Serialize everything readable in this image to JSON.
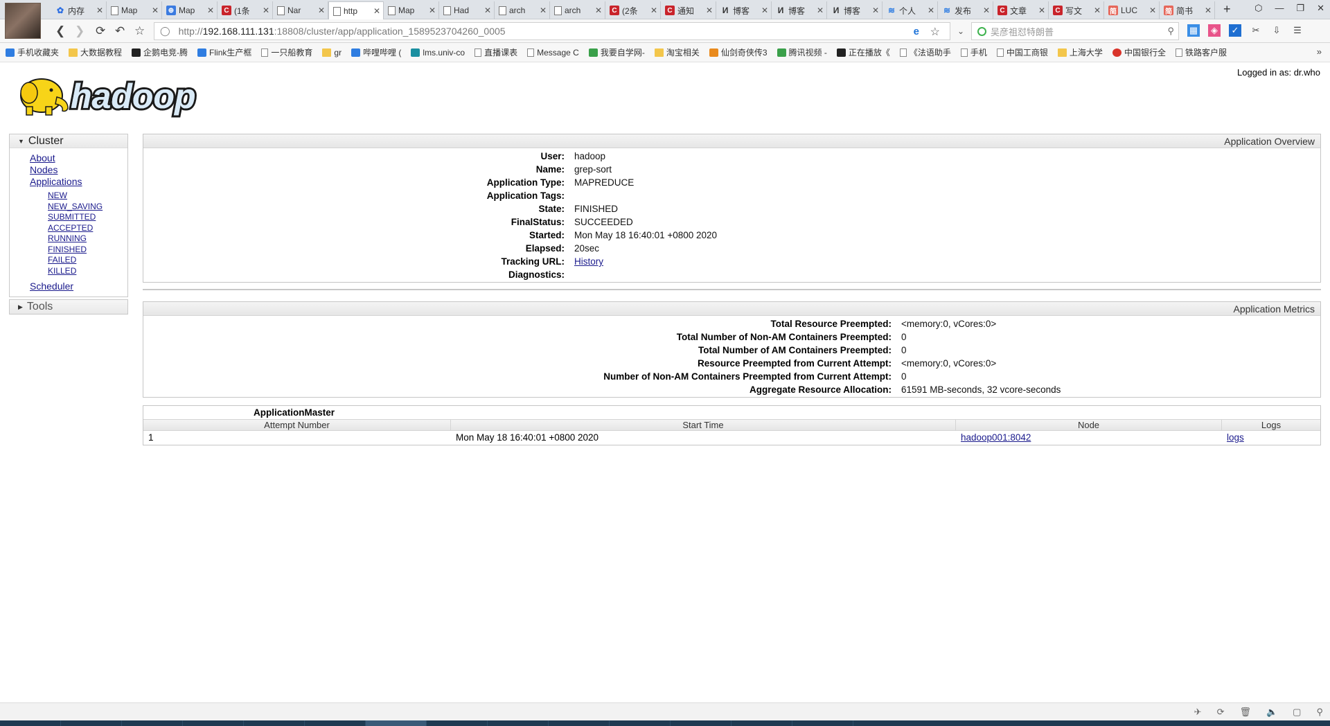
{
  "browser": {
    "tabs": [
      {
        "icon": "baidu",
        "title": "内存"
      },
      {
        "icon": "page",
        "title": "Map"
      },
      {
        "icon": "mapicon",
        "title": "Map"
      },
      {
        "icon": "csdn",
        "title": "(1条"
      },
      {
        "icon": "page",
        "title": "Nar"
      },
      {
        "icon": "page",
        "title": "http",
        "active": true
      },
      {
        "icon": "page",
        "title": "Map"
      },
      {
        "icon": "page",
        "title": "Had"
      },
      {
        "icon": "page",
        "title": "arch"
      },
      {
        "icon": "page",
        "title": "arch"
      },
      {
        "icon": "csdn",
        "title": "(2条"
      },
      {
        "icon": "csdn",
        "title": "通知"
      },
      {
        "icon": "blog",
        "title": "博客"
      },
      {
        "icon": "blog",
        "title": "博客"
      },
      {
        "icon": "blog",
        "title": "博客"
      },
      {
        "icon": "blue",
        "title": "个人"
      },
      {
        "icon": "blue",
        "title": "发布"
      },
      {
        "icon": "csdn",
        "title": "文章"
      },
      {
        "icon": "csdn",
        "title": "写文"
      },
      {
        "icon": "jian",
        "title": "LUC"
      },
      {
        "icon": "jian",
        "title": "简书"
      }
    ],
    "new_tab": "+",
    "address": {
      "prefix": "http://",
      "host": "192.168.111.131",
      "path": ":18808/cluster/app/application_1589523704260_0005"
    },
    "search_placeholder": "吴彦祖怼特朗普",
    "bookmarks": [
      {
        "icon": "blue",
        "label": "手机收藏夹"
      },
      {
        "icon": "folder",
        "label": "大数据教程"
      },
      {
        "icon": "black",
        "label": "企鹅电竞-腾"
      },
      {
        "icon": "blue",
        "label": "Flink生产框"
      },
      {
        "icon": "page",
        "label": "一只船教育"
      },
      {
        "icon": "folder",
        "label": "gr"
      },
      {
        "icon": "blue",
        "label": "哔哩哔哩 ("
      },
      {
        "icon": "teal",
        "label": "lms.univ-co"
      },
      {
        "icon": "page",
        "label": "直播课表"
      },
      {
        "icon": "page",
        "label": "Message C"
      },
      {
        "icon": "green",
        "label": "我要自学网-"
      },
      {
        "icon": "folder",
        "label": "淘宝相关"
      },
      {
        "icon": "orange",
        "label": "仙剑奇侠传3"
      },
      {
        "icon": "green",
        "label": "腾讯视频 -"
      },
      {
        "icon": "black",
        "label": "正在播放《"
      },
      {
        "icon": "page",
        "label": "《法语助手"
      },
      {
        "icon": "page",
        "label": "手机"
      },
      {
        "icon": "page",
        "label": "中国工商银"
      },
      {
        "icon": "folder",
        "label": "上海大学"
      },
      {
        "icon": "red",
        "label": "中国银行全"
      },
      {
        "icon": "page",
        "label": "铁路客户服"
      }
    ],
    "bookmarks_more": "»"
  },
  "page": {
    "logged_in": "Logged in as: dr.who",
    "nav": {
      "cluster_label": "Cluster",
      "tools_label": "Tools",
      "cluster_links": [
        "About",
        "Nodes",
        "Applications"
      ],
      "app_states": [
        "NEW",
        "NEW_SAVING",
        "SUBMITTED",
        "ACCEPTED",
        "RUNNING",
        "FINISHED",
        "FAILED",
        "KILLED"
      ],
      "scheduler_label": "Scheduler"
    },
    "overview": {
      "header": "Application Overview",
      "rows": [
        {
          "key": "User:",
          "value": "hadoop"
        },
        {
          "key": "Name:",
          "value": "grep-sort"
        },
        {
          "key": "Application Type:",
          "value": "MAPREDUCE"
        },
        {
          "key": "Application Tags:",
          "value": ""
        },
        {
          "key": "State:",
          "value": "FINISHED"
        },
        {
          "key": "FinalStatus:",
          "value": "SUCCEEDED"
        },
        {
          "key": "Started:",
          "value": "Mon May 18 16:40:01 +0800 2020"
        },
        {
          "key": "Elapsed:",
          "value": "20sec"
        },
        {
          "key": "Tracking URL:",
          "value": "History",
          "link": true
        },
        {
          "key": "Diagnostics:",
          "value": ""
        }
      ]
    },
    "metrics": {
      "header": "Application Metrics",
      "rows": [
        {
          "key": "Total Resource Preempted:",
          "value": "<memory:0, vCores:0>"
        },
        {
          "key": "Total Number of Non-AM Containers Preempted:",
          "value": "0"
        },
        {
          "key": "Total Number of AM Containers Preempted:",
          "value": "0"
        },
        {
          "key": "Resource Preempted from Current Attempt:",
          "value": "<memory:0, vCores:0>"
        },
        {
          "key": "Number of Non-AM Containers Preempted from Current Attempt:",
          "value": "0"
        },
        {
          "key": "Aggregate Resource Allocation:",
          "value": "61591 MB-seconds, 32 vcore-seconds"
        }
      ]
    },
    "am": {
      "title": "ApplicationMaster",
      "columns": [
        "Attempt Number",
        "Start Time",
        "Node",
        "Logs"
      ],
      "rows": [
        {
          "attempt": "1",
          "start": "Mon May 18 16:40:01 +0800 2020",
          "node": "hadoop001:8042",
          "logs": "logs"
        }
      ]
    }
  }
}
